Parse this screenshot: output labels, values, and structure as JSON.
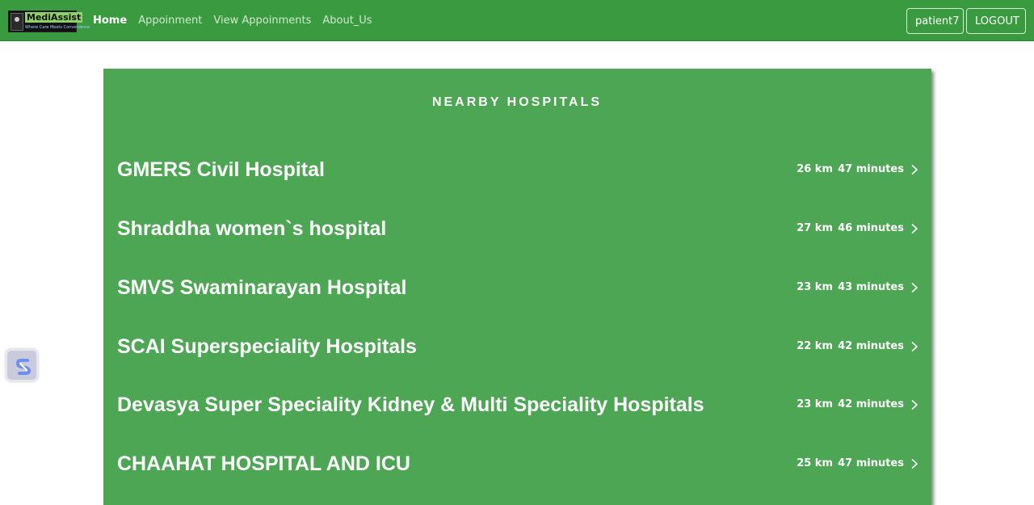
{
  "brand": {
    "name": "MediAssist",
    "tagline": "Where Care Meets Convenience"
  },
  "nav": {
    "links": [
      {
        "label": "Home",
        "active": true
      },
      {
        "label": "Appoinment",
        "active": false
      },
      {
        "label": "View Appoinments",
        "active": false
      },
      {
        "label": "About_Us",
        "active": false
      }
    ],
    "user_label": "patient7",
    "logout_label": "LOGOUT"
  },
  "section": {
    "title": "NEARBY HOSPITALS"
  },
  "hospitals": [
    {
      "name": "GMERS Civil Hospital",
      "distance": "26 km",
      "duration": "47 minutes"
    },
    {
      "name": "Shraddha women`s hospital",
      "distance": "27 km",
      "duration": "46 minutes"
    },
    {
      "name": "SMVS Swaminarayan Hospital",
      "distance": "23 km",
      "duration": "43 minutes"
    },
    {
      "name": "SCAI Superspeciality Hospitals",
      "distance": "22 km",
      "duration": "42 minutes"
    },
    {
      "name": "Devasya Super Speciality Kidney & Multi Speciality Hospitals",
      "distance": "23 km",
      "duration": "42 minutes"
    },
    {
      "name": "CHAAHAT HOSPITAL AND ICU",
      "distance": "25 km",
      "duration": "47 minutes"
    }
  ],
  "colors": {
    "navbar": "#3a9a3f",
    "card": "#4ca653",
    "text": "#ffffff"
  },
  "icons": {
    "row_arrow": "chevron-right-icon",
    "widget": "extension-s-icon"
  }
}
